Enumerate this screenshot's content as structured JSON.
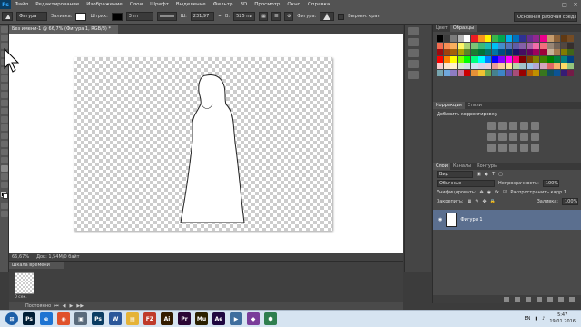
{
  "menubar": {
    "logo": "Ps",
    "items": [
      "Файл",
      "Редактирование",
      "Изображение",
      "Слои",
      "Шрифт",
      "Выделение",
      "Фильтр",
      "3D",
      "Просмотр",
      "Окно",
      "Справка"
    ]
  },
  "options": {
    "tool_mode": "Фигура",
    "fill_label": "Заливка:",
    "stroke_label": "Штрих:",
    "stroke_size": "3 пт",
    "width_label": "Ш:",
    "width_value": "231,97",
    "height_label": "В:",
    "height_value": "525 пи",
    "shape_label": "Фигура:",
    "align_edges": "Выровн. края",
    "workspace": "Основная рабочая среда"
  },
  "document": {
    "tab_title": "Без имени-1 @ 66,7% (Фигура 1, RGB/8) *"
  },
  "statusbar": {
    "zoom": "66,67%",
    "doc_info": "Док: 1,54M/0 байт"
  },
  "timeline": {
    "tab": "Шкала времени",
    "frame_duration": "0 сек.",
    "loop": "Постоянно"
  },
  "right_panel": {
    "top_tabs": [
      "Цвет",
      "Образцы"
    ],
    "adj_tabs": [
      "Коррекция",
      "Стили"
    ],
    "adj_title": "Добавить корректировку",
    "layer_tabs": [
      "Слои",
      "Каналы",
      "Контуры"
    ],
    "kind": "Вид",
    "blend_mode": "Обычные",
    "opacity_label": "Непрозрачность:",
    "opacity_value": "100%",
    "unify_label": "Унифицировать:",
    "propagate_label": "Распространить кадр 1",
    "lock_label": "Закрепить:",
    "fill_label": "Заливка:",
    "fill_value": "100%",
    "layer_name": "Фигура 1"
  },
  "swatch_colors": [
    "#000000",
    "#3c3c3c",
    "#7b7b7b",
    "#b4b4b4",
    "#ffffff",
    "#ed1c24",
    "#f7941d",
    "#fff200",
    "#39b54a",
    "#00a651",
    "#00aeef",
    "#0072bc",
    "#2e3192",
    "#662d91",
    "#92278f",
    "#ec008c",
    "#c69c6d",
    "#8c6239",
    "#603913",
    "#754c24",
    "#f26c4f",
    "#f68e55",
    "#fbaf5d",
    "#fff568",
    "#acd372",
    "#7cc576",
    "#3bb878",
    "#1abbb4",
    "#00bff3",
    "#438ccb",
    "#5574b9",
    "#605ca8",
    "#855fa8",
    "#a763a8",
    "#f06ea9",
    "#f26d7d",
    "#998675",
    "#736357",
    "#534741",
    "#362f2d",
    "#9e0b0f",
    "#a0410d",
    "#a36209",
    "#aba000",
    "#598527",
    "#1a7b30",
    "#007236",
    "#00746b",
    "#0076a3",
    "#004b80",
    "#003471",
    "#1b1464",
    "#440e62",
    "#630460",
    "#9e005d",
    "#9e0039",
    "#c7b299",
    "#a67c52",
    "#827b00",
    "#406618",
    "#ff0000",
    "#ff8000",
    "#ffff00",
    "#80ff00",
    "#00ff00",
    "#00ff80",
    "#00ffff",
    "#0080ff",
    "#0000ff",
    "#8000ff",
    "#ff00ff",
    "#ff0080",
    "#800000",
    "#804000",
    "#808000",
    "#408000",
    "#008000",
    "#008040",
    "#008080",
    "#004080",
    "#f4cccc",
    "#fce5cd",
    "#fff2cc",
    "#d9ead3",
    "#d0e0e3",
    "#cfe2f3",
    "#d9d2e9",
    "#ead1dc",
    "#ea9999",
    "#f9cb9c",
    "#ffe599",
    "#b6d7a8",
    "#a2c4c9",
    "#9fc5e8",
    "#b4a7d6",
    "#d5a6bd",
    "#e06666",
    "#f6b26b",
    "#ffd966",
    "#93c47d",
    "#76a5af",
    "#6fa8dc",
    "#8e7cc3",
    "#c27ba0",
    "#cc0000",
    "#e69138",
    "#f1c232",
    "#6aa84f",
    "#45818e",
    "#3d85c6",
    "#674ea7",
    "#a64d79",
    "#990000",
    "#b45f06",
    "#bf9000",
    "#38761d",
    "#134f5c",
    "#0b5394",
    "#351c75",
    "#741b47"
  ],
  "taskbar": {
    "apps": [
      {
        "label": "Ps",
        "color": "#001e36"
      },
      {
        "label": "e",
        "color": "#1e74d2"
      },
      {
        "label": "◉",
        "color": "#e0522b"
      },
      {
        "label": "▣",
        "color": "#5a6b7c"
      },
      {
        "label": "Ps",
        "color": "#0b3d63"
      },
      {
        "label": "W",
        "color": "#2b579a"
      },
      {
        "label": "▤",
        "color": "#e5b338"
      },
      {
        "label": "FZ",
        "color": "#bf3b2b"
      },
      {
        "label": "Ai",
        "color": "#331c00"
      },
      {
        "label": "Pr",
        "color": "#2a0634"
      },
      {
        "label": "Mu",
        "color": "#2a2000"
      },
      {
        "label": "Ae",
        "color": "#1f0740"
      },
      {
        "label": "▶",
        "color": "#3f6e9e"
      },
      {
        "label": "◆",
        "color": "#7a3d9a"
      },
      {
        "label": "⬢",
        "color": "#2f7f4f"
      }
    ],
    "lang": "EN",
    "time": "5:47",
    "date": "19.01.2016"
  }
}
